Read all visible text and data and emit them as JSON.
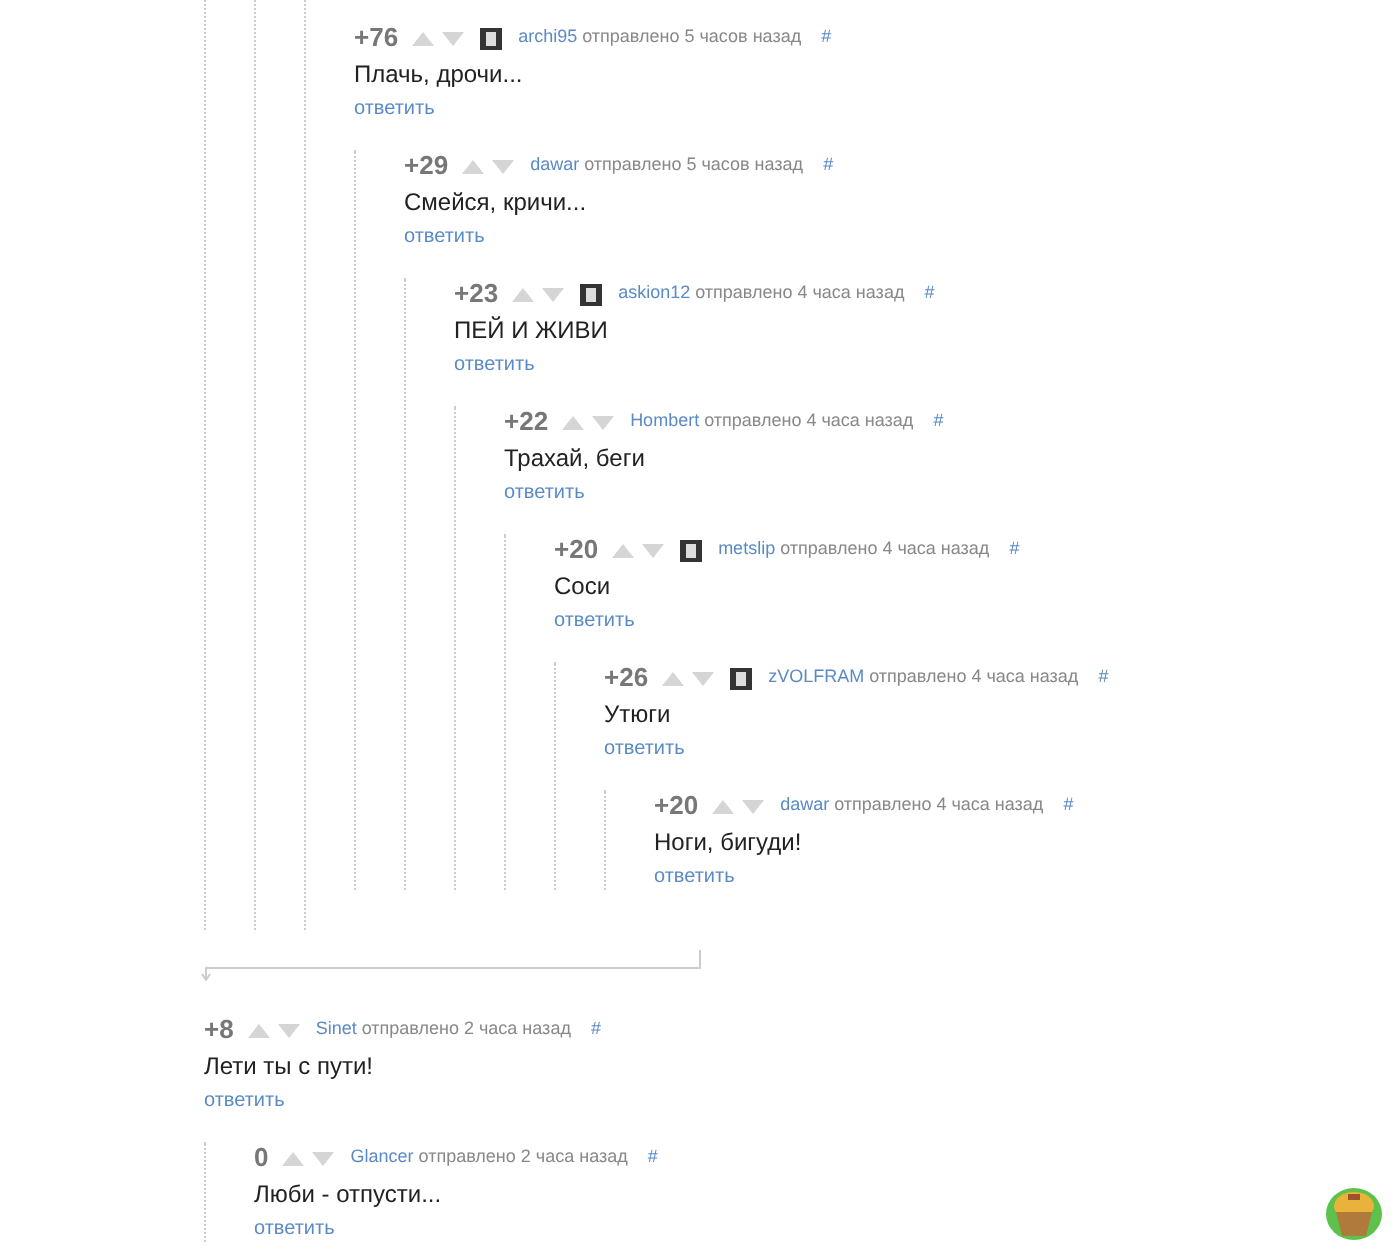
{
  "threads": [
    {
      "score": "+76",
      "avatar": true,
      "author": "archi95",
      "posted": "отправлено 5 часов назад",
      "anchor": "#",
      "text": "Плачь, дрочи...",
      "reply": "ответить",
      "children": [
        {
          "score": "+29",
          "author": "dawar",
          "posted": "отправлено 5 часов назад",
          "anchor": "#",
          "text": "Смейся, кричи...",
          "reply": "ответить",
          "children": [
            {
              "score": "+23",
              "avatar": true,
              "author": "askion12",
              "posted": "отправлено 4 часа назад",
              "anchor": "#",
              "text": "ПЕЙ И ЖИВИ",
              "reply": "ответить",
              "children": [
                {
                  "score": "+22",
                  "author": "Hombert",
                  "posted": "отправлено 4 часа назад",
                  "anchor": "#",
                  "text": "Трахай, беги",
                  "reply": "ответить",
                  "children": [
                    {
                      "score": "+20",
                      "avatar": true,
                      "author": "metslip",
                      "posted": "отправлено 4 часа назад",
                      "anchor": "#",
                      "text": "Соси",
                      "reply": "ответить",
                      "children": [
                        {
                          "score": "+26",
                          "avatar": true,
                          "author": "zVOLFRAM",
                          "posted": "отправлено 4 часа назад",
                          "anchor": "#",
                          "text": "Утюги",
                          "reply": "ответить",
                          "children": [
                            {
                              "score": "+20",
                              "author": "dawar",
                              "posted": "отправлено 4 часа назад",
                              "anchor": "#",
                              "text": "Ноги, бигуди!",
                              "reply": "ответить"
                            }
                          ]
                        }
                      ]
                    }
                  ]
                }
              ]
            }
          ]
        }
      ]
    },
    {
      "score": "+8",
      "author": "Sinet",
      "posted": "отправлено 2 часа назад",
      "anchor": "#",
      "text": "Лети ты с пути!",
      "reply": "ответить",
      "children": [
        {
          "score": "0",
          "author": "Glancer",
          "posted": "отправлено 2 часа назад",
          "anchor": "#",
          "text": "Люби - отпусти...",
          "reply": "ответить"
        }
      ]
    }
  ]
}
